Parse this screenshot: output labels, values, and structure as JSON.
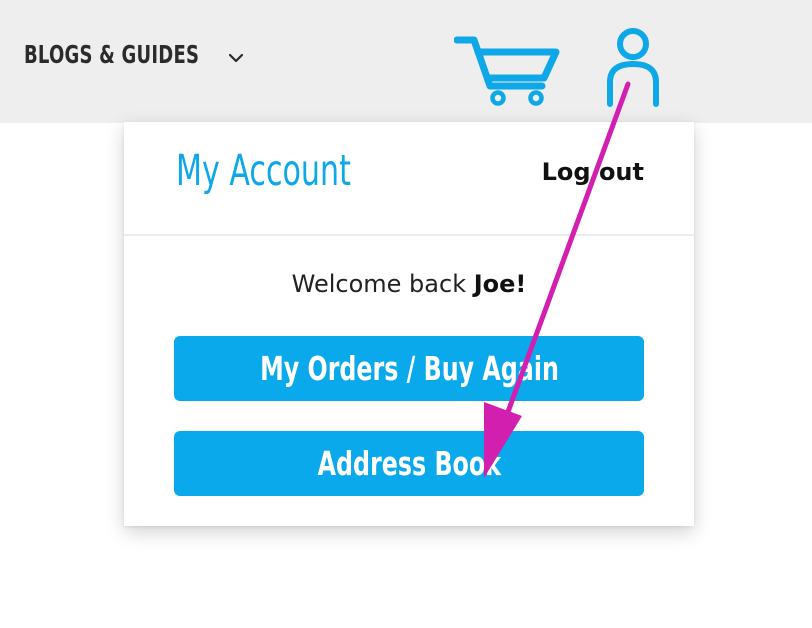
{
  "header": {
    "nav_blogs_label": "BLOGS & GUIDES",
    "chevron_icon": "chevron-down-icon",
    "cart_icon": "cart-icon",
    "account_icon": "account-icon"
  },
  "account_menu": {
    "title": "My Account",
    "logout_label": "Log out",
    "welcome_prefix": "Welcome back ",
    "welcome_name": "Joe!",
    "buttons": [
      {
        "label": "My Orders / Buy Again"
      },
      {
        "label": "Address Book"
      }
    ]
  },
  "annotation": {
    "arrow_color": "#d21fb0"
  },
  "colors": {
    "accent": "#0aa9ec",
    "header_bg": "#eeeeee",
    "text_dark": "#111111"
  }
}
